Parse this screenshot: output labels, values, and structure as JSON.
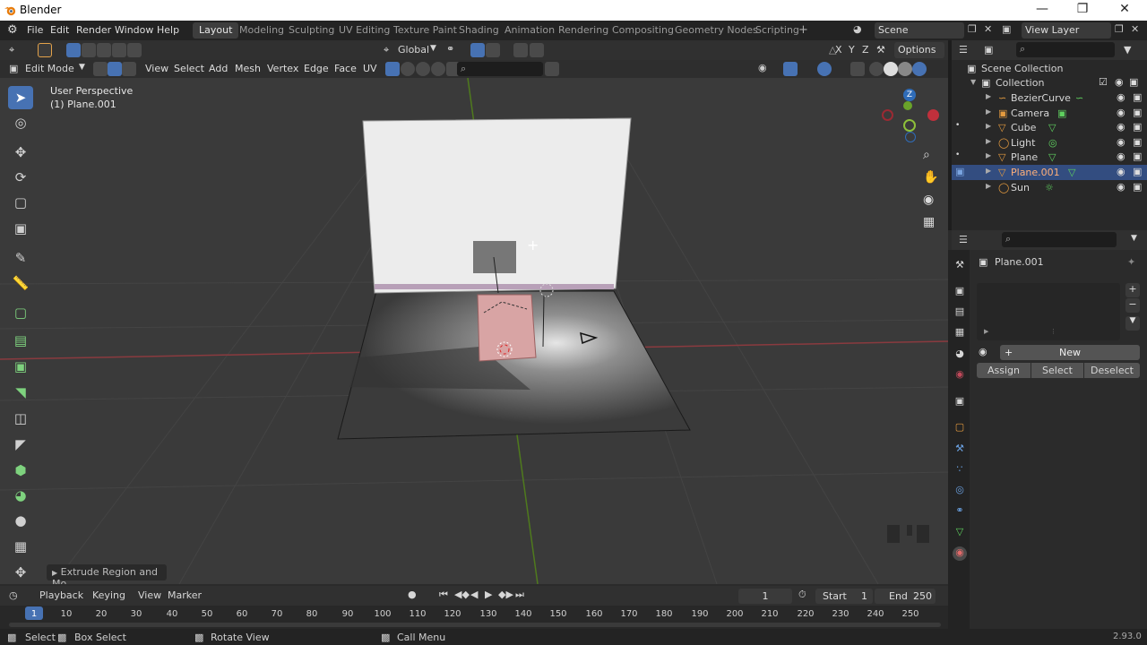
{
  "app": {
    "title": "Blender",
    "version": "2.93.0"
  },
  "menu": [
    "File",
    "Edit",
    "Render",
    "Window",
    "Help"
  ],
  "workspaces": [
    "Layout",
    "Modeling",
    "Sculpting",
    "UV Editing",
    "Texture Paint",
    "Shading",
    "Animation",
    "Rendering",
    "Compositing",
    "Geometry Nodes",
    "Scripting"
  ],
  "active_workspace": "Layout",
  "add_tab": "+",
  "scene": "Scene",
  "view_layer": "View Layer",
  "viewport": {
    "mode": "Edit Mode",
    "menus": [
      "View",
      "Select",
      "Add",
      "Mesh",
      "Vertex",
      "Edge",
      "Face",
      "UV"
    ],
    "transform_orientation": "Global",
    "options_label": "Options",
    "axis_x": "X",
    "axis_y": "Y",
    "axis_z": "Z",
    "overlay_line1": "User Perspective",
    "overlay_line2": "(1) Plane.001",
    "operator_panel": "Extrude Region and Mo",
    "gizmo_z": "Z"
  },
  "outliner": {
    "root": "Scene Collection",
    "collection": "Collection",
    "items": [
      {
        "name": "BezierCurve",
        "icon": "curve-icon"
      },
      {
        "name": "Camera",
        "icon": "camera-icon"
      },
      {
        "name": "Cube",
        "icon": "mesh-icon"
      },
      {
        "name": "Light",
        "icon": "light-icon"
      },
      {
        "name": "Plane",
        "icon": "mesh-icon"
      },
      {
        "name": "Plane.001",
        "icon": "mesh-icon",
        "selected": true
      },
      {
        "name": "Sun",
        "icon": "sun-icon"
      }
    ]
  },
  "properties": {
    "object_name": "Plane.001",
    "new_label": "New",
    "assign": "Assign",
    "select": "Select",
    "deselect": "Deselect",
    "list_add": "+",
    "list_remove": "−"
  },
  "timeline": {
    "menus": [
      "Playback",
      "Keying",
      "View",
      "Marker"
    ],
    "current_frame": "1",
    "start_label": "Start",
    "start": "1",
    "end_label": "End",
    "end": "250",
    "ticks": [
      "1",
      "10",
      "20",
      "30",
      "40",
      "50",
      "60",
      "70",
      "80",
      "90",
      "100",
      "110",
      "120",
      "130",
      "140",
      "150",
      "160",
      "170",
      "180",
      "190",
      "200",
      "210",
      "220",
      "230",
      "240",
      "250"
    ]
  },
  "statusbar": {
    "select": "Select",
    "box_select": "Box Select",
    "rotate_view": "Rotate View",
    "call_menu": "Call Menu"
  },
  "colors": {
    "accent": "#4772b3",
    "selected_row": "#334d80",
    "x_axis": "#b3343f",
    "y_axis": "#6a9a21"
  }
}
